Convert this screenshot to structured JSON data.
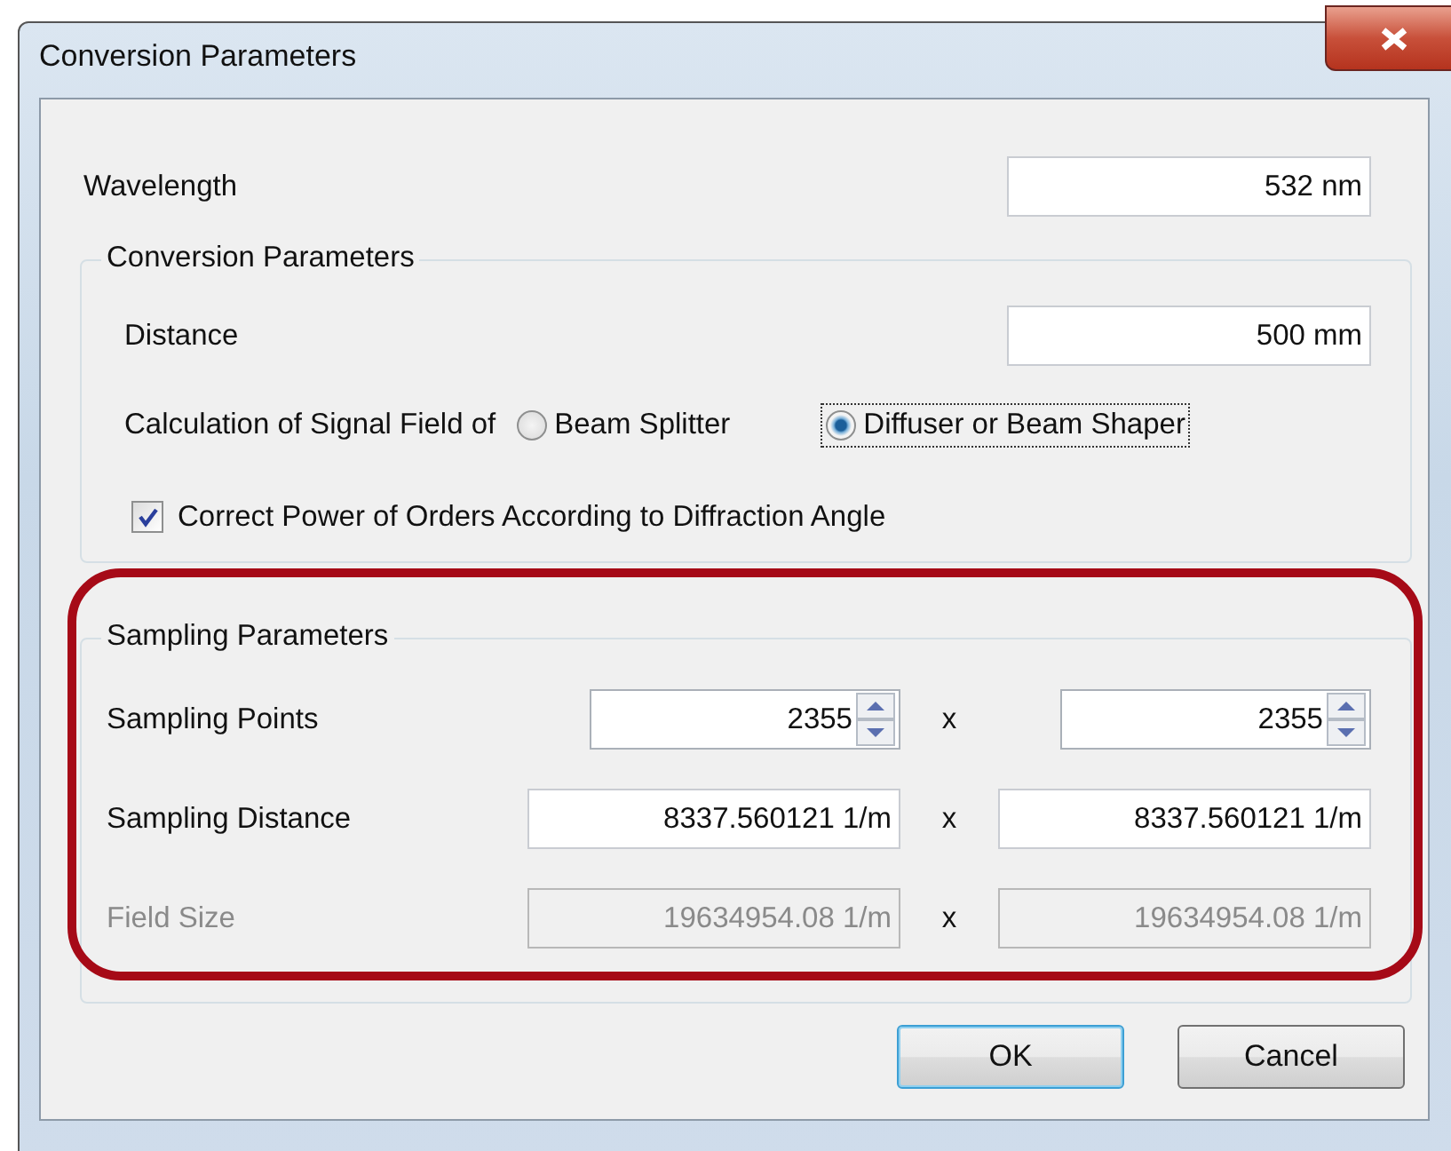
{
  "window": {
    "title": "Conversion Parameters"
  },
  "wavelength": {
    "label": "Wavelength",
    "value": "532 nm"
  },
  "conversion_group": {
    "title": "Conversion Parameters",
    "distance": {
      "label": "Distance",
      "value": "500 mm"
    },
    "calculation": {
      "label": "Calculation of Signal Field of",
      "options": [
        {
          "label": "Beam Splitter",
          "selected": false,
          "focused": false
        },
        {
          "label": "Diffuser or Beam Shaper",
          "selected": true,
          "focused": true
        }
      ]
    },
    "correct_power": {
      "label": "Correct Power of Orders According to Diffraction Angle",
      "checked": true
    }
  },
  "sampling_group": {
    "title": "Sampling Parameters",
    "highlighted": true,
    "rows": [
      {
        "label": "Sampling Points",
        "kind": "spin",
        "disabled": false,
        "separator": "x",
        "values": [
          "2355",
          "2355"
        ]
      },
      {
        "label": "Sampling Distance",
        "kind": "text",
        "disabled": false,
        "separator": "x",
        "values": [
          "8337.560121 1/m",
          "8337.560121 1/m"
        ]
      },
      {
        "label": "Field Size",
        "kind": "text",
        "disabled": true,
        "separator": "x",
        "values": [
          "19634954.08 1/m",
          "19634954.08 1/m"
        ]
      }
    ]
  },
  "buttons": [
    {
      "label": "OK",
      "default": true
    },
    {
      "label": "Cancel",
      "default": false
    }
  ]
}
